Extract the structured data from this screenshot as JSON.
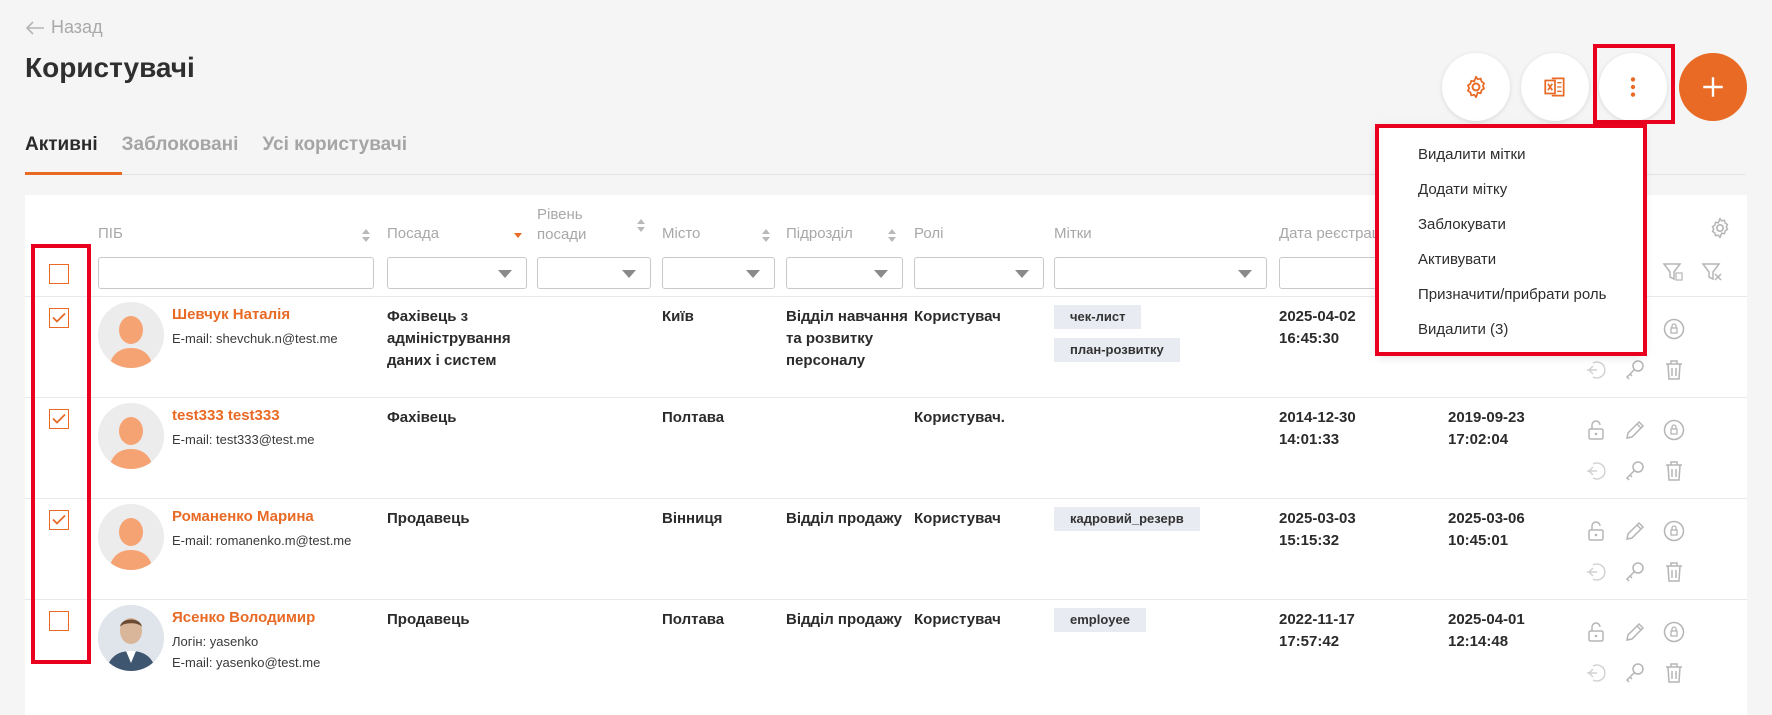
{
  "header": {
    "back_label": "Назад",
    "title": "Користувачі"
  },
  "toolbar": {
    "settings_icon": "gear-icon",
    "export_icon": "excel-icon",
    "more_icon": "vertical-dots-icon",
    "add_icon": "plus-icon"
  },
  "tabs": [
    {
      "label": "Активні",
      "active": true
    },
    {
      "label": "Заблоковані",
      "active": false
    },
    {
      "label": "Усі користувачі",
      "active": false
    }
  ],
  "columns": {
    "name": "ПІБ",
    "position": "Посада",
    "level_1": "Рівень",
    "level_2": "посади",
    "city": "Місто",
    "department": "Підрозділ",
    "roles": "Ролі",
    "tags": "Мітки",
    "reg_date": "Дата реєстрац"
  },
  "rows": [
    {
      "checked": true,
      "name": "Шевчук Наталія",
      "login": "",
      "email": "E-mail: shevchuk.n@test.me",
      "position_lines": [
        "Фахівець з",
        "адміністрування",
        "даних і систем"
      ],
      "city": "Київ",
      "department_lines": [
        "Відділ навчання",
        "та розвитку",
        "персоналу"
      ],
      "role": "Користувач",
      "tags": [
        "чек-лист",
        "план-розвитку"
      ],
      "reg_date": "2025-04-02",
      "reg_time": "16:45:30",
      "last_date": "",
      "last_time": ""
    },
    {
      "checked": true,
      "name": "test333 test333",
      "login": "",
      "email": "E-mail: test333@test.me",
      "position_lines": [
        "Фахівець"
      ],
      "city": "Полтава",
      "department_lines": [],
      "role": "Користувач.",
      "tags": [],
      "reg_date": "2014-12-30",
      "reg_time": "14:01:33",
      "last_date": "2019-09-23",
      "last_time": "17:02:04"
    },
    {
      "checked": true,
      "name": "Романенко Марина",
      "login": "",
      "email": "E-mail: romanenko.m@test.me",
      "position_lines": [
        "Продавець"
      ],
      "city": "Вінниця",
      "department_lines": [
        "Відділ продажу"
      ],
      "role": "Користувач",
      "tags": [
        "кадровий_резерв"
      ],
      "reg_date": "2025-03-03",
      "reg_time": "15:15:32",
      "last_date": "2025-03-06",
      "last_time": "10:45:01"
    },
    {
      "checked": false,
      "name": "Ясенко Володимир",
      "login": "Логін: yasenko",
      "email": "E-mail: yasenko@test.me",
      "position_lines": [
        "Продавець"
      ],
      "city": "Полтава",
      "department_lines": [
        "Відділ продажу"
      ],
      "role": "Користувач",
      "tags": [
        "employee"
      ],
      "reg_date": "2022-11-17",
      "reg_time": "17:57:42",
      "last_date": "2025-04-01",
      "last_time": "12:14:48"
    }
  ],
  "menu": {
    "items": [
      "Видалити мітки",
      "Додати мітку",
      "Заблокувати",
      "Активувати",
      "Призначити/прибрати роль",
      "Видалити (3)"
    ]
  },
  "colors": {
    "accent": "#e86a25",
    "highlight": "#e8001e"
  }
}
